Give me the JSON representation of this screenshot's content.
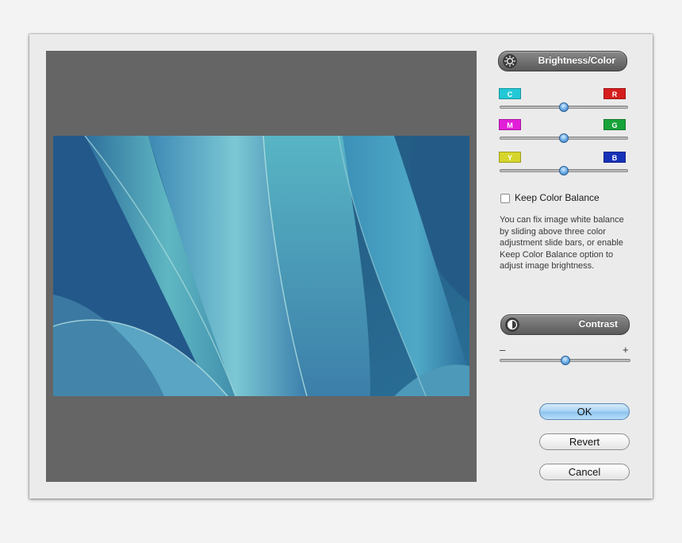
{
  "brightness_panel": {
    "title": "Brightness/Color",
    "icon": "sun-icon",
    "sliders": [
      {
        "left": "C",
        "right": "R",
        "left_color": "#22c8d6",
        "right_color": "#d61d1d",
        "value": 0.5
      },
      {
        "left": "M",
        "right": "G",
        "left_color": "#e21fd8",
        "right_color": "#18a33a",
        "value": 0.5
      },
      {
        "left": "Y",
        "right": "B",
        "left_color": "#d6d52b",
        "right_color": "#1531b8",
        "value": 0.5
      }
    ],
    "keep_balance_label": "Keep Color Balance",
    "keep_balance_checked": false,
    "help_text": "You can fix image white balance by sliding above three color adjustment slide bars, or enable Keep Color Balance option to adjust image brightness."
  },
  "contrast_panel": {
    "title": "Contrast",
    "icon": "contrast-icon",
    "minus": "–",
    "plus": "+",
    "value": 0.5
  },
  "buttons": {
    "ok": "OK",
    "revert": "Revert",
    "cancel": "Cancel"
  },
  "colors": {
    "accent": "#8cc3ef",
    "preview_bg": "#656565"
  }
}
